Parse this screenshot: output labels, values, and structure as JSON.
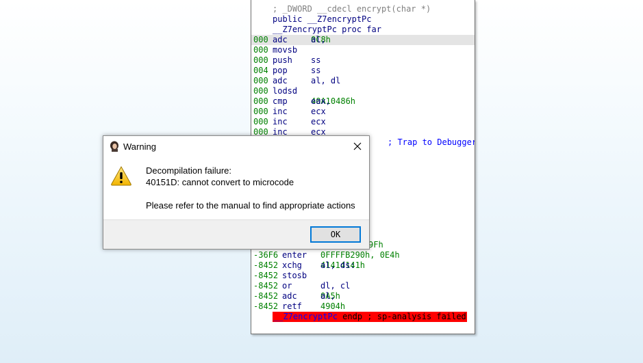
{
  "disassembly": {
    "header_comment": "; _DWORD __cdecl encrypt(char *)",
    "header_public": "public __Z7encryptPc",
    "header_proc": "__Z7encryptPc proc far",
    "lines": [
      {
        "sp": "000",
        "mnem": "adc",
        "op": "al, ",
        "num": "0C8h"
      },
      {
        "sp": "000",
        "mnem": "movsb",
        "op": "",
        "num": ""
      },
      {
        "sp": "000",
        "mnem": "push",
        "op": "ss",
        "num": ""
      },
      {
        "sp": "004",
        "mnem": "pop",
        "op": "ss",
        "num": ""
      },
      {
        "sp": "000",
        "mnem": "adc",
        "op": "al, dl",
        "num": ""
      },
      {
        "sp": "000",
        "mnem": "lodsd",
        "op": "",
        "num": ""
      },
      {
        "sp": "000",
        "mnem": "cmp",
        "op": "eax, ",
        "num": "40A10486h"
      },
      {
        "sp": "000",
        "mnem": "inc",
        "op": "ecx",
        "num": ""
      },
      {
        "sp": "000",
        "mnem": "inc",
        "op": "ecx",
        "num": ""
      },
      {
        "sp": "000",
        "mnem": "inc",
        "op": "ecx",
        "num": ""
      }
    ],
    "trap_comment": "; Trap to Debugger",
    "partial_num": "9Fh",
    "lower_lines": [
      {
        "sp": "-36F6",
        "mnem": "enter",
        "op": "",
        "num": "0FFFFB290h, 0E4h"
      },
      {
        "sp": "-8452",
        "mnem": "xchg",
        "op": "al, ds:",
        "num": "41414141h"
      },
      {
        "sp": "-8452",
        "mnem": "stosb",
        "op": "",
        "num": ""
      },
      {
        "sp": "-8452",
        "mnem": "or",
        "op": "dl, cl",
        "num": ""
      },
      {
        "sp": "-8452",
        "mnem": "adc",
        "op": "al, ",
        "num": "0A5h"
      },
      {
        "sp": "-8452",
        "mnem": "retf",
        "op": "",
        "num": "4904h"
      }
    ],
    "endp_name": "__Z7encryptPc",
    "endp_text": " endp ; sp-analysis failed"
  },
  "dialog": {
    "title": "Warning",
    "message_line1": "Decompilation failure:",
    "message_line2": "40151D: cannot convert to microcode",
    "message_line3": "Please refer to the manual to find appropriate actions",
    "ok_label": "OK"
  }
}
